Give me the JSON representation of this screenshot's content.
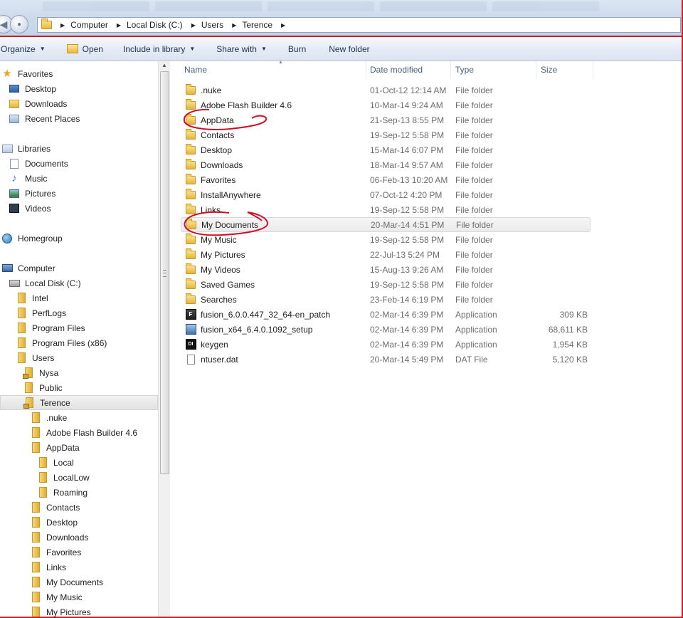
{
  "address_bar": {
    "crumbs": [
      "Computer",
      "Local Disk (C:)",
      "Users",
      "Terence"
    ]
  },
  "toolbar": {
    "organize": "Organize",
    "open": "Open",
    "include_in_library": "Include in library",
    "share_with": "Share with",
    "burn": "Burn",
    "new_folder": "New folder"
  },
  "nav": {
    "favorites": "Favorites",
    "desktop": "Desktop",
    "downloads": "Downloads",
    "recent_places": "Recent Places",
    "libraries": "Libraries",
    "documents": "Documents",
    "music": "Music",
    "pictures": "Pictures",
    "videos": "Videos",
    "homegroup": "Homegroup",
    "computer": "Computer",
    "local_disk": "Local Disk (C:)",
    "intel": "Intel",
    "perflogs": "PerfLogs",
    "program_files": "Program Files",
    "program_files_x86": "Program Files (x86)",
    "users": "Users",
    "nysa": "Nysa",
    "public": "Public",
    "terence": "Terence",
    "t_nuke": ".nuke",
    "t_adobe": "Adobe Flash Builder 4.6",
    "t_appdata": "AppData",
    "t_local": "Local",
    "t_locallow": "LocalLow",
    "t_roaming": "Roaming",
    "t_contacts": "Contacts",
    "t_desktop": "Desktop",
    "t_downloads": "Downloads",
    "t_favorites": "Favorites",
    "t_links": "Links",
    "t_mydocs": "My Documents",
    "t_mymusic": "My Music",
    "t_mypictures": "My Pictures"
  },
  "columns": {
    "name": "Name",
    "date_modified": "Date modified",
    "type": "Type",
    "size": "Size"
  },
  "files": [
    {
      "name": ".nuke",
      "date": "01-Oct-12 12:14 AM",
      "type": "File folder",
      "size": "",
      "icon": "folder-icon"
    },
    {
      "name": "Adobe Flash Builder 4.6",
      "date": "10-Mar-14 9:24 AM",
      "type": "File folder",
      "size": "",
      "icon": "folder-icon"
    },
    {
      "name": "AppData",
      "date": "21-Sep-13 8:55 PM",
      "type": "File folder",
      "size": "",
      "icon": "folder-icon"
    },
    {
      "name": "Contacts",
      "date": "19-Sep-12 5:58 PM",
      "type": "File folder",
      "size": "",
      "icon": "contacts-folder-icon"
    },
    {
      "name": "Desktop",
      "date": "15-Mar-14 6:07 PM",
      "type": "File folder",
      "size": "",
      "icon": "desktop-folder-icon"
    },
    {
      "name": "Downloads",
      "date": "18-Mar-14 9:57 AM",
      "type": "File folder",
      "size": "",
      "icon": "downloads-folder-icon"
    },
    {
      "name": "Favorites",
      "date": "06-Feb-13 10:20 AM",
      "type": "File folder",
      "size": "",
      "icon": "favorites-folder-icon"
    },
    {
      "name": "InstallAnywhere",
      "date": "07-Oct-12 4:20 PM",
      "type": "File folder",
      "size": "",
      "icon": "folder-icon"
    },
    {
      "name": "Links",
      "date": "19-Sep-12 5:58 PM",
      "type": "File folder",
      "size": "",
      "icon": "links-folder-icon"
    },
    {
      "name": "My Documents",
      "date": "20-Mar-14 4:51 PM",
      "type": "File folder",
      "size": "",
      "icon": "documents-folder-icon"
    },
    {
      "name": "My Music",
      "date": "19-Sep-12 5:58 PM",
      "type": "File folder",
      "size": "",
      "icon": "music-folder-icon"
    },
    {
      "name": "My Pictures",
      "date": "22-Jul-13 5:24 PM",
      "type": "File folder",
      "size": "",
      "icon": "pictures-folder-icon"
    },
    {
      "name": "My Videos",
      "date": "15-Aug-13 9:26 AM",
      "type": "File folder",
      "size": "",
      "icon": "videos-folder-icon"
    },
    {
      "name": "Saved Games",
      "date": "19-Sep-12 5:58 PM",
      "type": "File folder",
      "size": "",
      "icon": "games-folder-icon"
    },
    {
      "name": "Searches",
      "date": "23-Feb-14 6:19 PM",
      "type": "File folder",
      "size": "",
      "icon": "searches-folder-icon"
    },
    {
      "name": "fusion_6.0.0.447_32_64-en_patch",
      "date": "02-Mar-14 6:39 PM",
      "type": "Application",
      "size": "309 KB",
      "icon": "patch-app-icon"
    },
    {
      "name": "fusion_x64_6.4.0.1092_setup",
      "date": "02-Mar-14 6:39 PM",
      "type": "Application",
      "size": "68,611 KB",
      "icon": "setup-app-icon"
    },
    {
      "name": "keygen",
      "date": "02-Mar-14 6:39 PM",
      "type": "Application",
      "size": "1,954 KB",
      "icon": "keygen-app-icon"
    },
    {
      "name": "ntuser.dat",
      "date": "20-Mar-14 5:49 PM",
      "type": "DAT File",
      "size": "5,120 KB",
      "icon": "file-icon"
    }
  ],
  "colors": {
    "annotation_red": "#d0102a",
    "selection_border": "#d9d9d9"
  }
}
